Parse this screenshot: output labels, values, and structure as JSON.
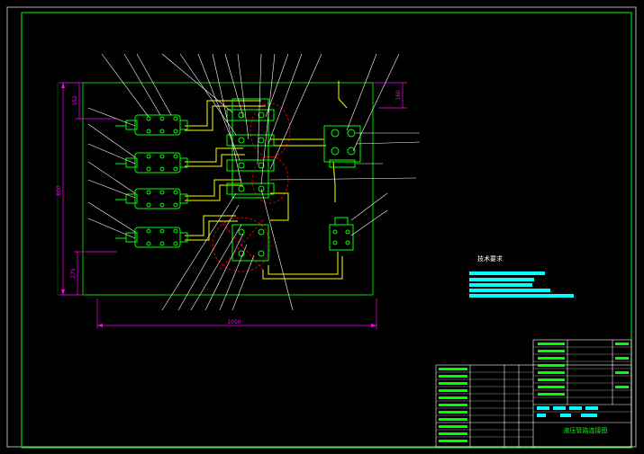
{
  "drawing": {
    "dimensions": {
      "overall_width": "1050",
      "overall_height": "800",
      "top_left_offset": "152",
      "top_right_offset": "160",
      "bottom_left_offset": "275"
    },
    "technical_requirements": {
      "heading": "技术要求"
    },
    "title_block": {
      "drawing_title": "液压管路连接图"
    },
    "colors": {
      "background": "#000000",
      "frame": "#00ff00",
      "dimension": "#ff00ff",
      "leader": "#ffffff",
      "pipe": "#ffff00",
      "component": "#00ff00",
      "hidden": "#ff0000",
      "highlight": "#00ffff"
    }
  }
}
